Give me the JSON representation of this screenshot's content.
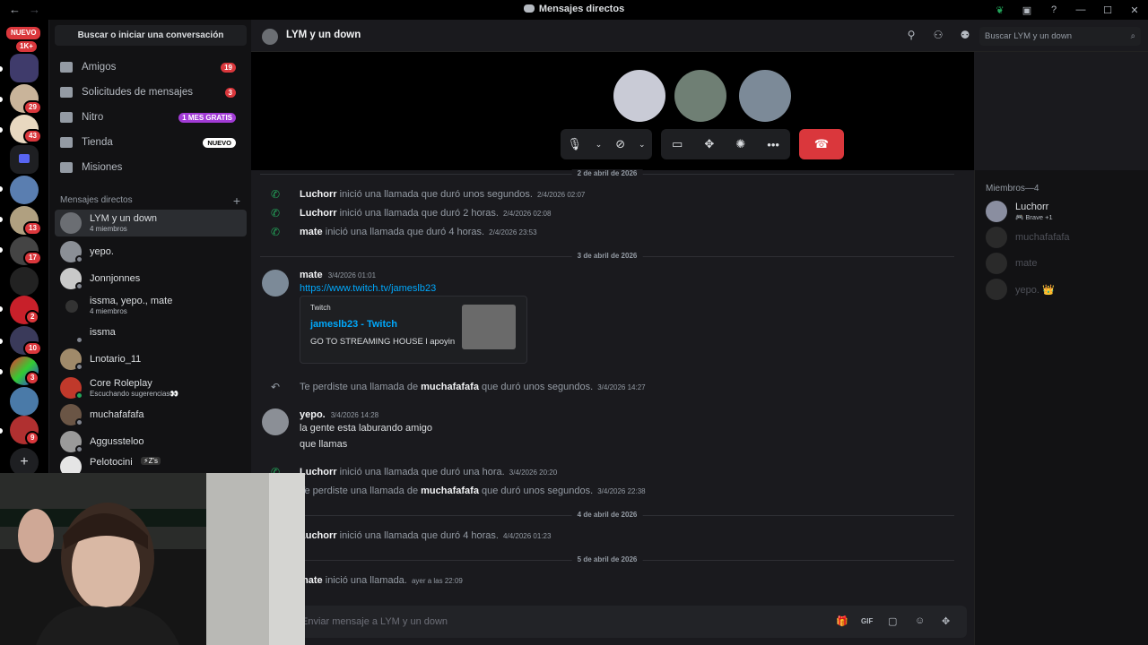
{
  "titlebar": {
    "title": "Mensajes directos",
    "back": "←",
    "forward": "→"
  },
  "servers": {
    "new_label": "NUEVO",
    "home_badge": "1K+",
    "badges": [
      "29",
      "43",
      "13",
      "17",
      "2",
      "10",
      "3",
      "9"
    ]
  },
  "dm_sidebar": {
    "search_label": "Buscar o iniciar una conversación",
    "nav": [
      {
        "label": "Amigos",
        "badge": "19"
      },
      {
        "label": "Solicitudes de mensajes",
        "badge": "3"
      },
      {
        "label": "Nitro",
        "badge": "1 MES GRATIS"
      },
      {
        "label": "Tienda",
        "badge": "NUEVO"
      },
      {
        "label": "Misiones"
      }
    ],
    "dm_header": "Mensajes directos",
    "dm_items": [
      {
        "name": "LYM y un down",
        "sub": "4 miembros",
        "color": "#6b6e73"
      },
      {
        "name": "yepo.",
        "sub": "",
        "color": "#8b8f96"
      },
      {
        "name": "Jonnjonnes",
        "sub": "",
        "color": "#c9c9c9"
      },
      {
        "name": "issma, yepo., mate",
        "sub": "4 miembros",
        "color": "#121214"
      },
      {
        "name": "issma",
        "sub": "",
        "color": "#121214"
      },
      {
        "name": "Lnotario_11",
        "sub": "",
        "color": "#a08a6a"
      },
      {
        "name": "Core Roleplay",
        "sub": "Escuchando sugerencias👀",
        "color": "#c0392b"
      },
      {
        "name": "muchafafafa",
        "sub": "",
        "color": "#6a5545"
      },
      {
        "name": "Aggussteloo",
        "sub": "",
        "color": "#9a9a9a"
      },
      {
        "name": "Pelotocini",
        "sub": "",
        "color": "#e5e5e5"
      }
    ],
    "pelotocini_tag": "⚡Z's"
  },
  "channel": {
    "name": "LYM y un down",
    "search_placeholder": "Buscar LYM y un down"
  },
  "messages": {
    "dividers": [
      "2 de abril de 2026",
      "3 de abril de 2026",
      "4 de abril de 2026",
      "5 de abril de 2026"
    ],
    "calls_day1": [
      {
        "user": "Luchorr",
        "text": "inició una llamada que duró unos segundos.",
        "ts": "2/4/2026 02:07"
      },
      {
        "user": "Luchorr",
        "text": "inició una llamada que duró 2 horas.",
        "ts": "2/4/2026 02:08"
      },
      {
        "user": "mate",
        "text": "inició una llamada que duró 4 horas.",
        "ts": "2/4/2026 23:53"
      }
    ],
    "mate_msg": {
      "author": "mate",
      "ts": "3/4/2026 01:01",
      "link": "https://www.twitch.tv/jameslb23",
      "embed_provider": "Twitch",
      "embed_title": "jameslb23 - Twitch",
      "embed_desc": "GO TO STREAMING HOUSE l apoyin"
    },
    "missed1": {
      "pre": "Te perdiste una llamada de",
      "user": "muchafafafa",
      "post": "que duró unos segundos.",
      "ts": "3/4/2026 14:27"
    },
    "yepo_msg": {
      "author": "yepo.",
      "ts": "3/4/2026 14:28",
      "lines": [
        "la gente esta laburando amigo",
        "que llamas"
      ]
    },
    "call_hour": {
      "user": "Luchorr",
      "text": "inició una llamada que duró una hora.",
      "ts": "3/4/2026 20:20"
    },
    "missed2": {
      "pre": "Te perdiste una llamada de",
      "user": "muchafafafa",
      "post": "que duró unos segundos.",
      "ts": "3/4/2026 22:38"
    },
    "call_day4": {
      "user": "Luchorr",
      "text": "inició una llamada que duró 4 horas.",
      "ts": "4/4/2026 01:23"
    },
    "call_day5": {
      "user": "mate",
      "text": "inició una llamada.",
      "ts": "ayer a las 22:09"
    }
  },
  "composer": {
    "placeholder": "Enviar mensaje a LYM y un down"
  },
  "members": {
    "header": "Miembros—4",
    "list": [
      {
        "name": "Luchorr",
        "status": "🎮 Brave +1",
        "color": "#8a8ea0"
      },
      {
        "name": "muchafafafa",
        "color": "#3a3a3a"
      },
      {
        "name": "mate",
        "color": "#3a3a3a"
      },
      {
        "name": "yepo. 👑",
        "color": "#3a3a3a"
      }
    ]
  },
  "colors": {
    "accent": "#5865f2",
    "danger": "#da373c",
    "link": "#00a8fc",
    "online": "#23a55a"
  }
}
